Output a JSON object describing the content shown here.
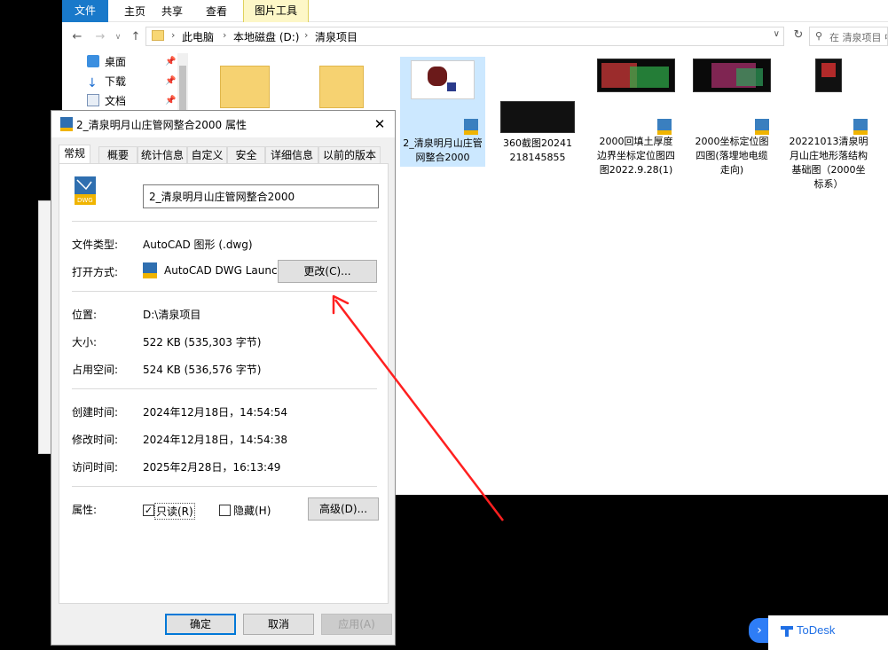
{
  "ribbon": {
    "tabs": [
      "文件",
      "主页",
      "共享",
      "查看",
      "图片工具"
    ]
  },
  "address": {
    "crumbs": [
      "此电脑",
      "本地磁盘 (D:)",
      "清泉项目"
    ],
    "search_placeholder": "在 清泉项目 中搜"
  },
  "navpane": {
    "items": [
      {
        "label": "桌面",
        "icon": "desktop-icon"
      },
      {
        "label": "下载",
        "icon": "download-icon"
      },
      {
        "label": "文档",
        "icon": "document-icon"
      }
    ]
  },
  "files": [
    {
      "name": "2_清泉明月山庄管网整合2000",
      "type": "dwg",
      "selected": true
    },
    {
      "name": "360截图20241218145855",
      "type": "image"
    },
    {
      "name": "2000回填土厚度边界坐标定位图四图2022.9.28(1)",
      "type": "dwg"
    },
    {
      "name": "2000坐标定位图四图(落埋地电缆走向)",
      "type": "dwg"
    },
    {
      "name": "20221013清泉明月山庄地形落结构基础图（2000坐标系）",
      "type": "dwg"
    }
  ],
  "dialog": {
    "title": "2_清泉明月山庄管网整合2000 属性",
    "tabs": [
      "常规",
      "概要",
      "统计信息",
      "自定义",
      "安全",
      "详细信息",
      "以前的版本"
    ],
    "filename": "2_清泉明月山庄管网整合2000",
    "file_type_label": "文件类型:",
    "file_type": "AutoCAD 图形 (.dwg)",
    "open_with_label": "打开方式:",
    "open_with": "AutoCAD DWG Launch",
    "change_button": "更改(C)...",
    "location_label": "位置:",
    "location": "D:\\清泉项目",
    "size_label": "大小:",
    "size": "522 KB (535,303 字节)",
    "disk_size_label": "占用空间:",
    "disk_size": "524 KB (536,576 字节)",
    "created_label": "创建时间:",
    "created": "2024年12月18日，14:54:54",
    "modified_label": "修改时间:",
    "modified": "2024年12月18日，14:54:38",
    "accessed_label": "访问时间:",
    "accessed": "2025年2月28日，16:13:49",
    "attributes_label": "属性:",
    "readonly_label": "只读(R)",
    "readonly_checked": true,
    "hidden_label": "隐藏(H)",
    "hidden_checked": false,
    "advanced_button": "高级(D)...",
    "ok_button": "确定",
    "cancel_button": "取消",
    "apply_button": "应用(A)"
  },
  "todesk": {
    "label": "ToDesk"
  },
  "colors": {
    "accent": "#1979ca",
    "arrow": "#ff2020",
    "todesk": "#2e7df6"
  }
}
